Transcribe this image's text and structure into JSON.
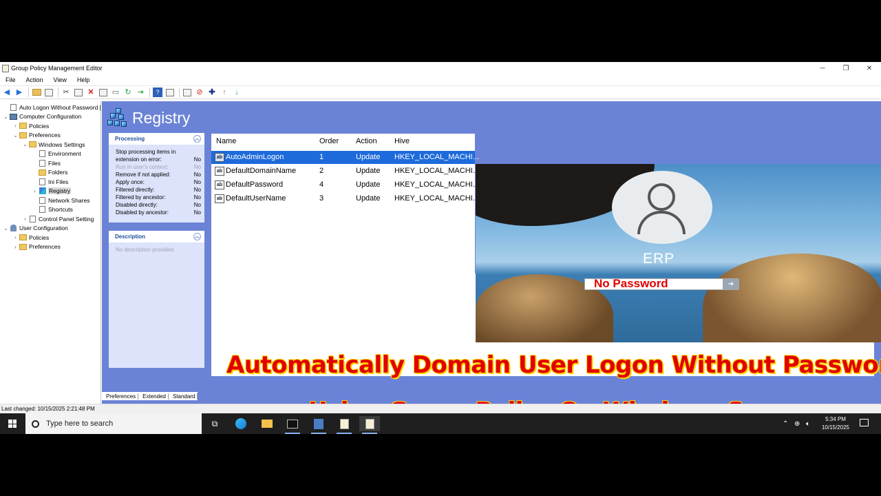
{
  "window": {
    "title": "Group Policy Management Editor",
    "controls": {
      "minimize": "─",
      "restore": "❐",
      "close": "✕"
    }
  },
  "menu": [
    "File",
    "Action",
    "View",
    "Help"
  ],
  "tree": {
    "items": [
      {
        "label": "Auto Logon Without Password [I",
        "depth": 0,
        "expander": "",
        "icon": "policy-icon"
      },
      {
        "label": "Computer Configuration",
        "depth": 0,
        "expander": "⌄",
        "icon": "computer-icon"
      },
      {
        "label": "Policies",
        "depth": 1,
        "expander": "›",
        "icon": "folder-icon"
      },
      {
        "label": "Preferences",
        "depth": 1,
        "expander": "⌄",
        "icon": "folder-icon"
      },
      {
        "label": "Windows Settings",
        "depth": 2,
        "expander": "⌄",
        "icon": "folder-icon"
      },
      {
        "label": "Environment",
        "depth": 3,
        "expander": "",
        "icon": "environment-icon"
      },
      {
        "label": "Files",
        "depth": 3,
        "expander": "",
        "icon": "files-icon"
      },
      {
        "label": "Folders",
        "depth": 3,
        "expander": "",
        "icon": "folder-icon"
      },
      {
        "label": "Ini Files",
        "depth": 3,
        "expander": "",
        "icon": "ini-files-icon"
      },
      {
        "label": "Registry",
        "depth": 3,
        "expander": "›",
        "icon": "registry-icon",
        "selected": true
      },
      {
        "label": "Network Shares",
        "depth": 3,
        "expander": "",
        "icon": "network-shares-icon"
      },
      {
        "label": "Shortcuts",
        "depth": 3,
        "expander": "",
        "icon": "shortcuts-icon"
      },
      {
        "label": "Control Panel Setting",
        "depth": 2,
        "expander": "›",
        "icon": "control-panel-icon"
      },
      {
        "label": "User Configuration",
        "depth": 0,
        "expander": "⌄",
        "icon": "user-icon"
      },
      {
        "label": "Policies",
        "depth": 1,
        "expander": "›",
        "icon": "folder-icon"
      },
      {
        "label": "Preferences",
        "depth": 1,
        "expander": "›",
        "icon": "folder-icon"
      }
    ]
  },
  "registry": {
    "title": "Registry",
    "processing": {
      "heading": "Processing",
      "rows": [
        {
          "label": "Stop processing items in",
          "value": ""
        },
        {
          "label": "extension on error:",
          "value": "No"
        },
        {
          "label": "Run in user's context:",
          "value": "No",
          "dim": true
        },
        {
          "label": "Remove if not applied:",
          "value": "No"
        },
        {
          "label": "Apply once:",
          "value": "No"
        },
        {
          "label": "Filtered directly:",
          "value": "No"
        },
        {
          "label": "Filtered by ancestor:",
          "value": "No"
        },
        {
          "label": "Disabled directly:",
          "value": "No"
        },
        {
          "label": "Disabled by ancestor:",
          "value": "No"
        }
      ]
    },
    "description": {
      "heading": "Description",
      "text": "No description provided."
    },
    "columns": {
      "name": "Name",
      "order": "Order",
      "action": "Action",
      "hive": "Hive"
    },
    "rows": [
      {
        "name": "AutoAdminLogon",
        "order": "1",
        "action": "Update",
        "hive": "HKEY_LOCAL_MACHI...",
        "selected": true,
        "icon_text": "ab"
      },
      {
        "name": "DefaultDomainName",
        "order": "2",
        "action": "Update",
        "hive": "HKEY_LOCAL_MACHI...",
        "icon_text": "ab"
      },
      {
        "name": "DefaultPassword",
        "order": "4",
        "action": "Update",
        "hive": "HKEY_LOCAL_MACHI...",
        "icon_text": "ab"
      },
      {
        "name": "DefaultUserName",
        "order": "3",
        "action": "Update",
        "hive": "HKEY_LOCAL_MACHI...",
        "icon_text": "ab"
      }
    ]
  },
  "overlay": {
    "login_user": "ERP",
    "password_text": "No Password",
    "headline1": "Automatically Domain User Logon Without Password",
    "headline2": "Using Group Policy On Windows Server",
    "headline_color": "#e00000",
    "outline_color": "#ffd400"
  },
  "bottom_tabs": [
    "Preferences",
    "Extended",
    "Standard"
  ],
  "status": "Last changed: 10/15/2025 2:21:48 PM",
  "taskbar": {
    "search_placeholder": "Type here to search",
    "time": "5:34 PM",
    "date": "10/15/2025",
    "pinned": [
      "task-view-icon",
      "edge-icon",
      "file-explorer-icon",
      "terminal-icon",
      "server-manager-icon",
      "gpmc-icon",
      "gp-editor-icon"
    ]
  },
  "colors": {
    "pane_bg": "#6b83d6",
    "selection": "#1d6bdb",
    "panel_bg": "#dce3fb"
  }
}
